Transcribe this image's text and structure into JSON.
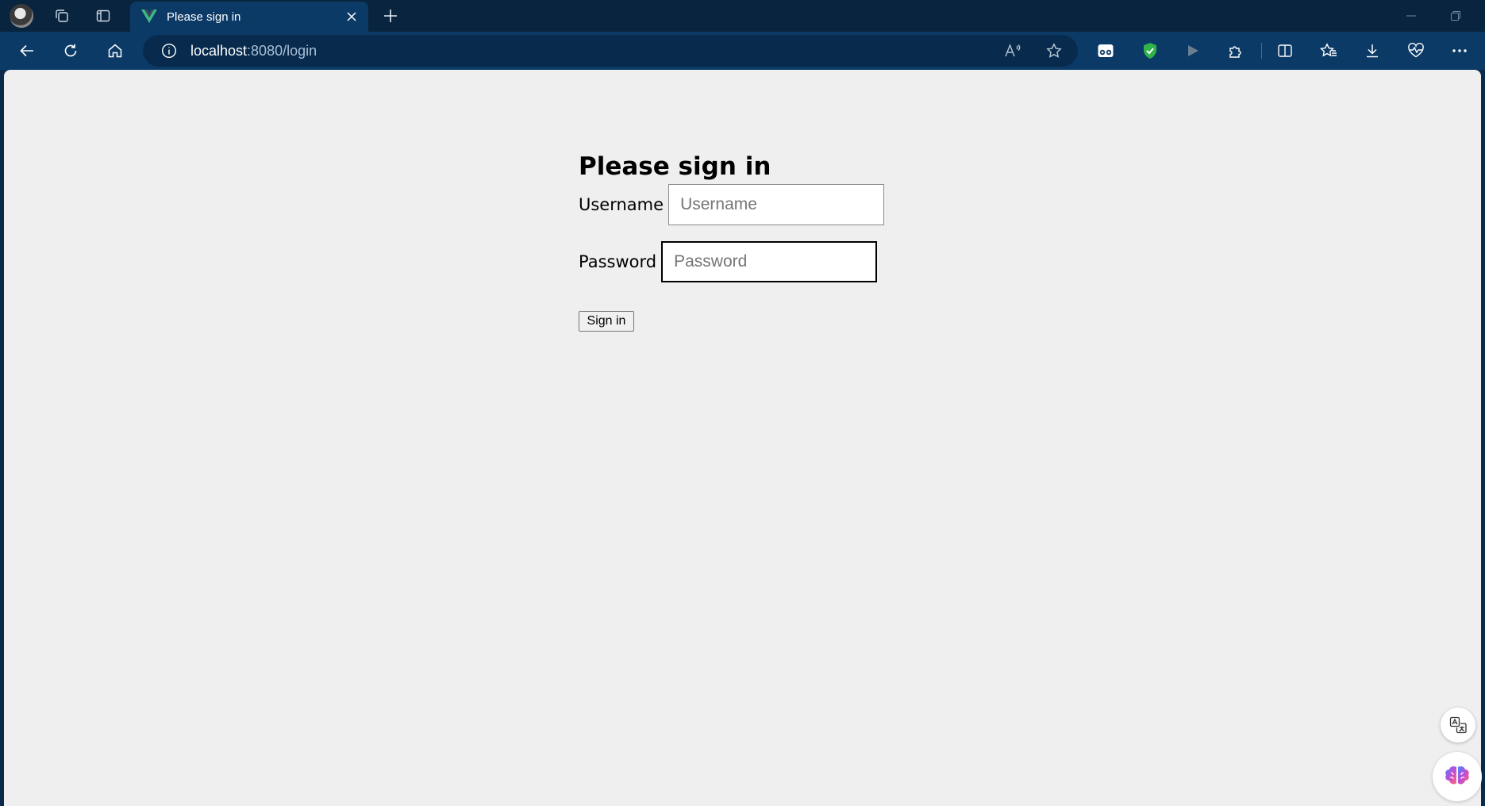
{
  "browser": {
    "tab": {
      "title": "Please sign in",
      "favicon": "vue-logo-icon"
    },
    "address": {
      "host": "localhost",
      "path": ":8080/login"
    },
    "colors": {
      "tabstrip": "#08243f",
      "toolbar": "#0c3a66",
      "omnibox": "#072a4d",
      "favicon_green": "#41b883",
      "shield_green": "#2fb34a"
    },
    "read_aloud_label": "Aʆ"
  },
  "page": {
    "heading": "Please sign in",
    "username": {
      "label": "Username",
      "placeholder": "Username"
    },
    "password": {
      "label": "Password",
      "placeholder": "Password"
    },
    "signin_label": "Sign in",
    "background": "#efefef"
  }
}
